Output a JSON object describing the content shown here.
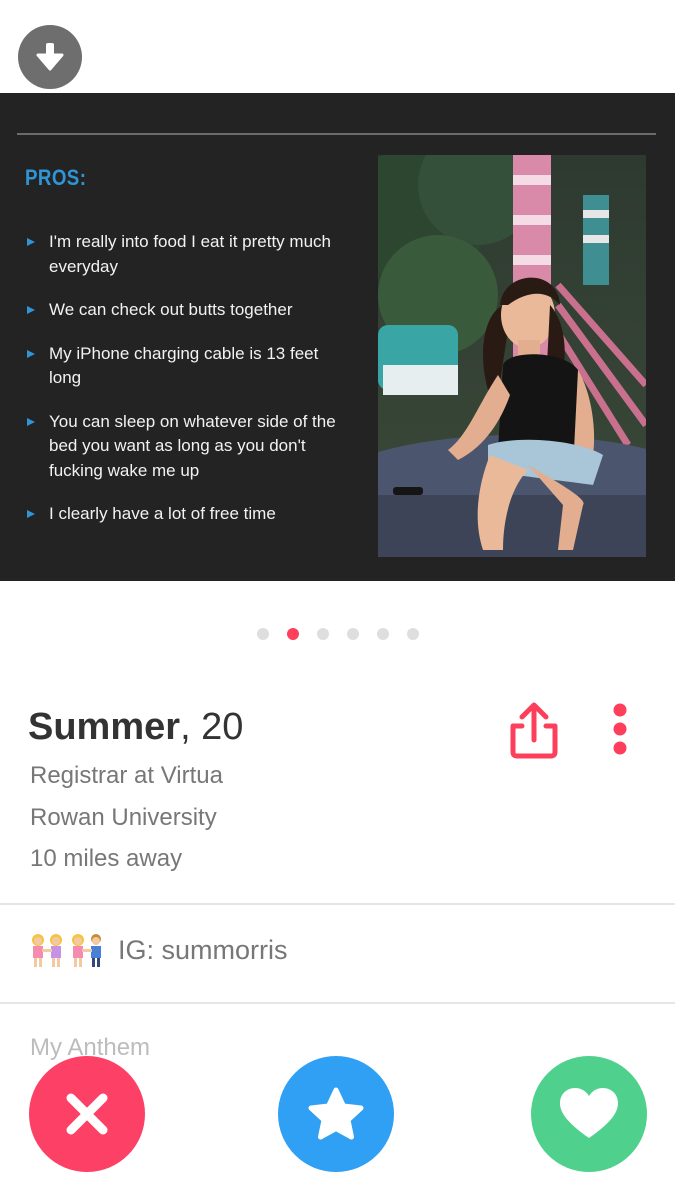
{
  "slide": {
    "pros_title": "PROS:",
    "pros": [
      "I'm really into food I eat it pretty much everyday",
      "We can check out butts together",
      "My iPhone charging cable is 13 feet long",
      "You can sleep on whatever side of the bed you want as long as you don't fucking wake me up",
      "I clearly have a lot of free time"
    ]
  },
  "pagination": {
    "total": 6,
    "active": 2
  },
  "profile": {
    "name": "Summer",
    "age": ", 20",
    "job": "Registrar at Virtua",
    "school": "Rowan University",
    "distance": "10 miles away",
    "bio": "IG: summorris",
    "anthem_label": "My Anthem"
  },
  "colors": {
    "accent": "#fd3f5c",
    "nope": "#fd4065",
    "superlike": "#2fa0f4",
    "like": "#4fd08d",
    "pros_blue": "#2f95d6"
  },
  "icons": {
    "collapse": "arrow-down-icon",
    "share": "share-icon",
    "more": "more-vertical-icon",
    "nope": "close-icon",
    "superlike": "star-icon",
    "like": "heart-icon"
  }
}
